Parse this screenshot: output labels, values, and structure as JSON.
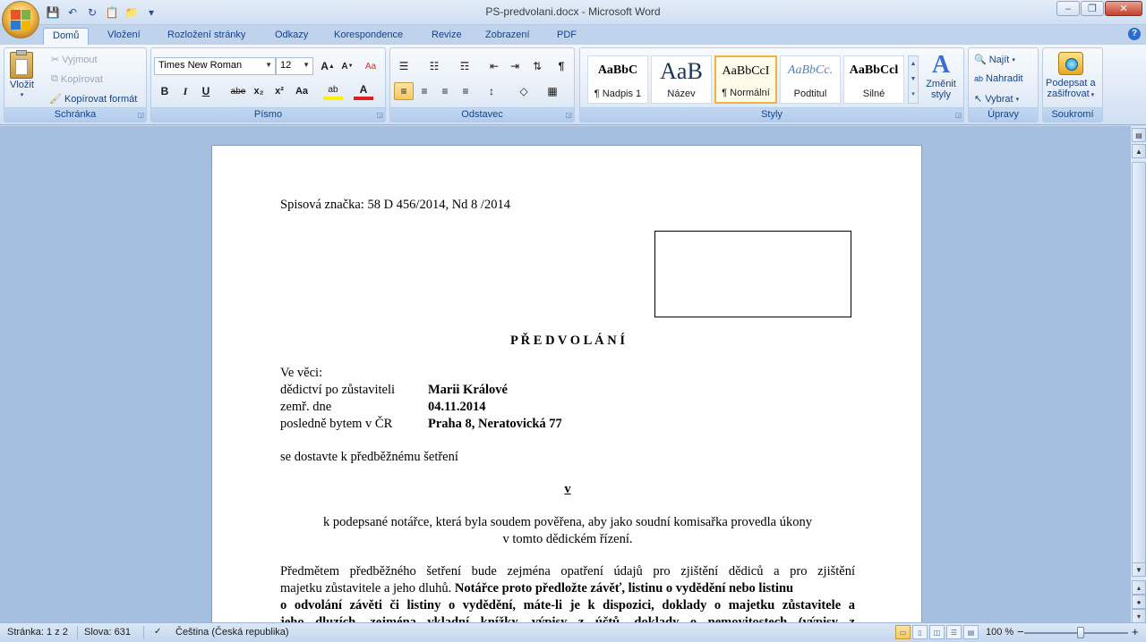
{
  "window": {
    "title": "PS-predvolani.docx - Microsoft Word",
    "minimize": "–",
    "maximize": "❐",
    "close": "✕"
  },
  "qat": {
    "save": "💾",
    "undo": "↶",
    "redo": "↻",
    "paste": "📋",
    "open": "📁",
    "customize": "▾"
  },
  "tabs": [
    "Domů",
    "Vložení",
    "Rozložení stránky",
    "Odkazy",
    "Korespondence",
    "Revize",
    "Zobrazení",
    "PDF"
  ],
  "help": "?",
  "ribbon": {
    "clipboard": {
      "label": "Schránka",
      "paste": "Vložit",
      "cut": "Vyjmout",
      "copy": "Kopírovat",
      "format_painter": "Kopírovat formát"
    },
    "font": {
      "label": "Písmo",
      "font_name": "Times New Roman",
      "font_size": "12",
      "grow": "A",
      "shrink": "A",
      "clear": "Aa",
      "bold": "B",
      "italic": "I",
      "underline": "U",
      "strike": "abe",
      "subscript": "x₂",
      "superscript": "x²",
      "change_case": "Aa",
      "highlight": "ab",
      "font_color": "A"
    },
    "paragraph": {
      "label": "Odstavec",
      "bullets": "☰",
      "numbering": "☷",
      "multilevel": "☶",
      "decrease_indent": "⇤",
      "increase_indent": "⇥",
      "sort": "⇅",
      "show_marks": "¶",
      "align_left": "≡",
      "align_center": "≡",
      "align_right": "≡",
      "justify": "≡",
      "line_spacing": "↕",
      "shading": "◇",
      "borders": "▦"
    },
    "styles": {
      "label": "Styly",
      "items": [
        {
          "preview": "AaBbC",
          "name": "¶ Nadpis 1"
        },
        {
          "preview": "AaB",
          "name": "Název"
        },
        {
          "preview": "AaBbCcI",
          "name": "¶ Normální"
        },
        {
          "preview": "AaBbCc.",
          "name": "Podtitul"
        },
        {
          "preview": "AaBbCcl",
          "name": "Silné"
        }
      ],
      "change_styles": "Změnit styly"
    },
    "editing": {
      "label": "Úpravy",
      "find": "Najít",
      "replace": "Nahradit",
      "select": "Vybrat"
    },
    "privacy": {
      "label": "Soukromí",
      "sign_encrypt_1": "Podepsat a",
      "sign_encrypt_2": "zašifrovat"
    }
  },
  "document": {
    "file_ref": "Spisová značka: 58 D 456/2014,  Nd 8 /2014",
    "title": "P Ř E D V O L Á N Í",
    "in_matter": "Ve věci:",
    "rows": [
      {
        "label": "dědictví po zůstaviteli",
        "value": "Marii Králové"
      },
      {
        "label": "zemř. dne",
        "value": "04.11.2014"
      },
      {
        "label": "posledně bytem v ČR",
        "value": "Praha 8, Neratovická 77"
      }
    ],
    "summon": "se dostavte k předběžnému šetření",
    "v": "v",
    "notary_1": "k podepsané notářce, která byla soudem pověřena, aby jako soudní komisařka  provedla úkony",
    "notary_2": "v tomto dědickém řízení.",
    "body_1a": "Předmětem předběžného šetření bude zejména opatření údajů pro zjištění dědiců a pro zjištění",
    "body_2a": "majetku zůstavitele a jeho dluhů.",
    "body_2b": " Notářce proto předložte závěť, listinu o vydědění nebo listinu",
    "body_3": "o odvolání závěti či listiny o vydědění, máte-li je k dispozici, doklady o majetku zůstavitele a",
    "body_4": "jeho dluzích, zejména vkladní knížky, výpisy z účtů, doklady o nemovitostech (výpisy z"
  },
  "status": {
    "page": "Stránka: 1 z 2",
    "words": "Slova: 631",
    "language": "Čeština (Česká republika)",
    "zoom": "100 %",
    "zoom_out": "−",
    "zoom_in": "+"
  }
}
